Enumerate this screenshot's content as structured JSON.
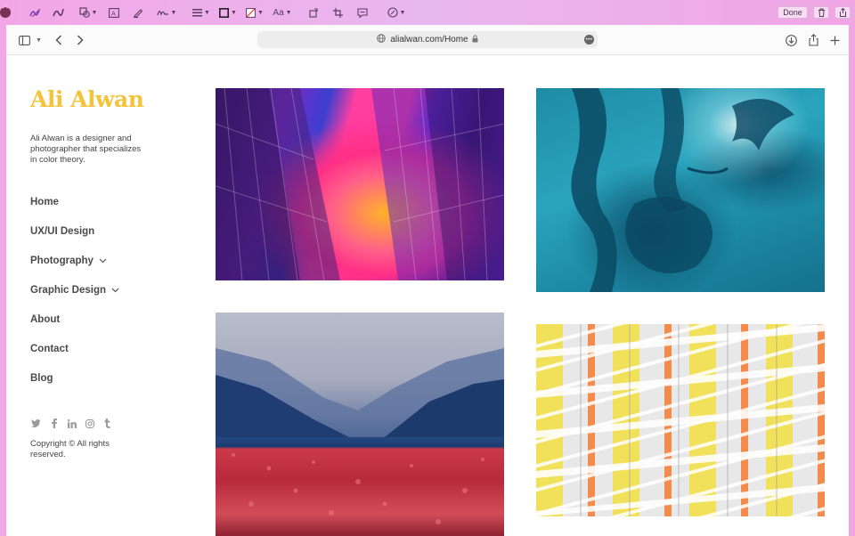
{
  "markup_toolbar": {
    "done_label": "Done",
    "text_style_label": "Aa"
  },
  "browser": {
    "address": "alialwan.com/Home"
  },
  "site": {
    "title": "Ali Alwan",
    "tagline": "Ali Alwan is a designer and photographer that specializes in color theory.",
    "nav": [
      {
        "label": "Home",
        "has_submenu": false
      },
      {
        "label": "UX/UI Design",
        "has_submenu": false
      },
      {
        "label": "Photography",
        "has_submenu": true
      },
      {
        "label": "Graphic Design",
        "has_submenu": true
      },
      {
        "label": "About",
        "has_submenu": false
      },
      {
        "label": "Contact",
        "has_submenu": false
      },
      {
        "label": "Blog",
        "has_submenu": false
      }
    ],
    "social_icons": [
      "twitter-icon",
      "facebook-icon",
      "linkedin-icon",
      "instagram-icon",
      "tumblr-icon"
    ],
    "copyright": "Copyright © All rights reserved."
  },
  "colors": {
    "title": "#f4c339",
    "nav_text": "#4a4a4a",
    "toolbar_bg": "#f3a6e6"
  }
}
